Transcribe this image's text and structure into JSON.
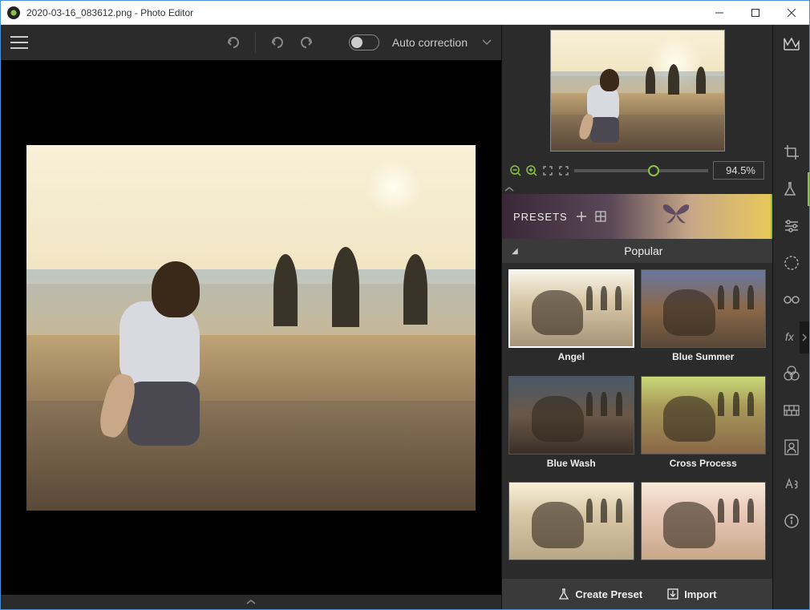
{
  "window": {
    "title": "2020-03-16_083612.png - Photo Editor"
  },
  "toolbar": {
    "auto_correction": "Auto correction"
  },
  "zoom": {
    "value": "94.5%"
  },
  "presets": {
    "header_label": "PRESETS",
    "category": "Popular",
    "items": [
      {
        "name": "Angel"
      },
      {
        "name": "Blue Summer"
      },
      {
        "name": "Blue Wash"
      },
      {
        "name": "Cross Process"
      },
      {
        "name": ""
      },
      {
        "name": ""
      }
    ],
    "create_label": "Create Preset",
    "import_label": "Import"
  }
}
